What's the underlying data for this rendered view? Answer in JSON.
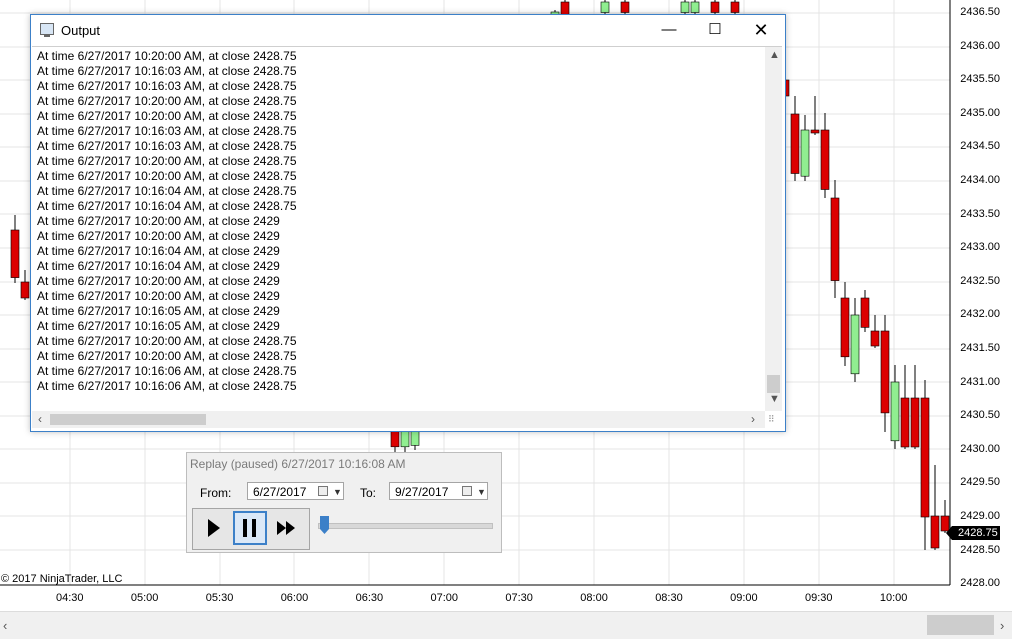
{
  "chart": {
    "price_labels": [
      "2436.50",
      "2436.00",
      "2435.50",
      "2435.00",
      "2434.50",
      "2434.00",
      "2433.50",
      "2433.00",
      "2432.50",
      "2432.00",
      "2431.50",
      "2431.00",
      "2430.50",
      "2430.00",
      "2429.50",
      "2429.00",
      "2428.50",
      "2428.00"
    ],
    "time_labels": [
      "04:30",
      "05:00",
      "05:30",
      "06:00",
      "06:30",
      "07:00",
      "07:30",
      "08:00",
      "08:30",
      "09:00",
      "09:30",
      "10:00"
    ],
    "current_price": "2428.75",
    "copyright": "© 2017 NinjaTrader, LLC",
    "up_color": "#90ee90",
    "down_color": "#dc0000"
  },
  "output_window": {
    "title": "Output",
    "minimize_icon": "minimize-icon",
    "maximize_icon": "maximize-icon",
    "close_icon": "close-icon",
    "lines": [
      "At time 6/27/2017 10:20:00 AM, at close 2428.75",
      "At time 6/27/2017 10:16:03 AM, at close 2428.75",
      "At time 6/27/2017 10:16:03 AM, at close 2428.75",
      "At time 6/27/2017 10:20:00 AM, at close 2428.75",
      "At time 6/27/2017 10:20:00 AM, at close 2428.75",
      "At time 6/27/2017 10:16:03 AM, at close 2428.75",
      "At time 6/27/2017 10:16:03 AM, at close 2428.75",
      "At time 6/27/2017 10:20:00 AM, at close 2428.75",
      "At time 6/27/2017 10:20:00 AM, at close 2428.75",
      "At time 6/27/2017 10:16:04 AM, at close 2428.75",
      "At time 6/27/2017 10:16:04 AM, at close 2428.75",
      "At time 6/27/2017 10:20:00 AM, at close 2429",
      "At time 6/27/2017 10:20:00 AM, at close 2429",
      "At time 6/27/2017 10:16:04 AM, at close 2429",
      "At time 6/27/2017 10:16:04 AM, at close 2429",
      "At time 6/27/2017 10:20:00 AM, at close 2429",
      "At time 6/27/2017 10:20:00 AM, at close 2429",
      "At time 6/27/2017 10:16:05 AM, at close 2429",
      "At time 6/27/2017 10:16:05 AM, at close 2429",
      "At time 6/27/2017 10:20:00 AM, at close 2428.75",
      "At time 6/27/2017 10:20:00 AM, at close 2428.75",
      "At time 6/27/2017 10:16:06 AM, at close 2428.75",
      "At time 6/27/2017 10:16:06 AM, at close 2428.75"
    ]
  },
  "replay": {
    "title": "Replay (paused) 6/27/2017 10:16:08 AM",
    "from_label": "From:",
    "from_value": "6/27/2017",
    "to_label": "To:",
    "to_value": "9/27/2017",
    "play_icon": "play-icon",
    "pause_icon": "pause-icon",
    "fast_forward_icon": "fast-forward-icon"
  }
}
